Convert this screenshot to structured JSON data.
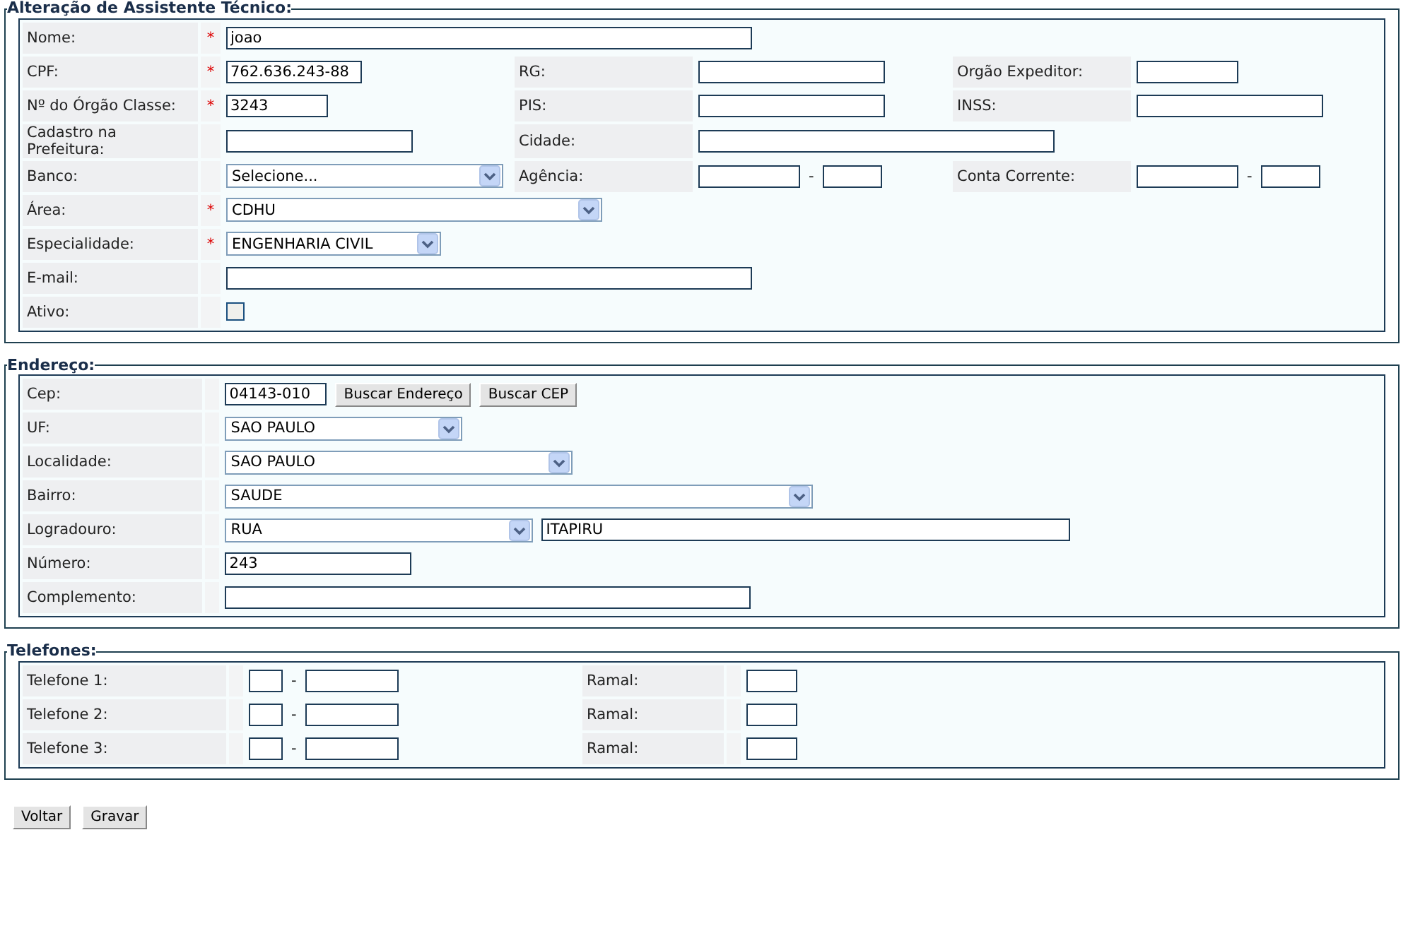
{
  "sections": [
    {
      "title": "Alteração de Assistente Técnico:",
      "rows": [
        {
          "label": "Nome:",
          "required_mark": "*",
          "controls": [
            {
              "kind": "input",
              "value": "joao"
            }
          ]
        },
        {
          "label": "CPF:",
          "required_mark": "*",
          "controls": [
            {
              "kind": "input",
              "value": "762.636.243-88"
            }
          ],
          "extras": [
            {
              "label": "RG:",
              "controls": [
                {
                  "kind": "input"
                }
              ]
            },
            {
              "label": "Orgão Expeditor:",
              "controls": [
                {
                  "kind": "input"
                }
              ]
            }
          ]
        },
        {
          "label": "Nº do Órgão Classe:",
          "required_mark": "*",
          "controls": [
            {
              "kind": "input",
              "value": "3243"
            }
          ],
          "extras": [
            {
              "label": "PIS:",
              "controls": [
                {
                  "kind": "input"
                }
              ]
            },
            {
              "label": "INSS:",
              "controls": [
                {
                  "kind": "input"
                }
              ]
            }
          ]
        },
        {
          "label": "Cadastro na Prefeitura:",
          "controls": [
            {
              "kind": "input"
            }
          ],
          "extras": [
            {
              "label": "Cidade:",
              "controls": [
                {
                  "kind": "input"
                }
              ]
            }
          ]
        },
        {
          "label": "Banco:",
          "controls": [
            {
              "kind": "select",
              "value": "Selecione..."
            }
          ],
          "extras": [
            {
              "label": "Agência:",
              "controls": [
                {
                  "kind": "input"
                },
                {
                  "kind": "dash",
                  "text": "-"
                },
                {
                  "kind": "input"
                }
              ]
            },
            {
              "label": "Conta Corrente:",
              "controls": [
                {
                  "kind": "input"
                },
                {
                  "kind": "dash",
                  "text": "-"
                },
                {
                  "kind": "input"
                }
              ]
            }
          ]
        },
        {
          "label": "Área:",
          "required_mark": "*",
          "controls": [
            {
              "kind": "select",
              "value": "CDHU"
            }
          ]
        },
        {
          "label": "Especialidade:",
          "required_mark": "*",
          "controls": [
            {
              "kind": "select",
              "value": "ENGENHARIA CIVIL"
            }
          ]
        },
        {
          "label": "E-mail:",
          "controls": [
            {
              "kind": "input"
            }
          ]
        },
        {
          "label": "Ativo:",
          "controls": [
            {
              "kind": "checkbox",
              "checked": false
            }
          ]
        }
      ]
    },
    {
      "title": "Endereço:",
      "rows": [
        {
          "label": "Cep:",
          "controls": [
            {
              "kind": "input",
              "value": "04143-010"
            },
            {
              "kind": "button",
              "text": "Buscar Endereço"
            },
            {
              "kind": "button",
              "text": "Buscar CEP"
            }
          ]
        },
        {
          "label": "UF:",
          "controls": [
            {
              "kind": "select",
              "value": "SAO PAULO"
            }
          ]
        },
        {
          "label": "Localidade:",
          "controls": [
            {
              "kind": "select",
              "value": "SAO PAULO"
            }
          ]
        },
        {
          "label": "Bairro:",
          "controls": [
            {
              "kind": "select",
              "value": "SAUDE"
            }
          ]
        },
        {
          "label": "Logradouro:",
          "controls": [
            {
              "kind": "select",
              "value": "RUA"
            },
            {
              "kind": "input",
              "value": "ITAPIRU"
            }
          ]
        },
        {
          "label": "Número:",
          "controls": [
            {
              "kind": "input",
              "value": "243"
            }
          ]
        },
        {
          "label": "Complemento:",
          "controls": [
            {
              "kind": "input"
            }
          ]
        }
      ]
    },
    {
      "title": "Telefones:",
      "rows": [
        {
          "label": "Telefone 1:",
          "controls": [
            {
              "kind": "input"
            },
            {
              "kind": "dash",
              "text": "-"
            },
            {
              "kind": "input"
            }
          ],
          "extras": [
            {
              "label": "Ramal:",
              "controls": [
                {
                  "kind": "input"
                }
              ]
            }
          ]
        },
        {
          "label": "Telefone 2:",
          "controls": [
            {
              "kind": "input"
            },
            {
              "kind": "dash",
              "text": "-"
            },
            {
              "kind": "input"
            }
          ],
          "extras": [
            {
              "label": "Ramal:",
              "controls": [
                {
                  "kind": "input"
                }
              ]
            }
          ]
        },
        {
          "label": "Telefone 3:",
          "controls": [
            {
              "kind": "input"
            },
            {
              "kind": "dash",
              "text": "-"
            },
            {
              "kind": "input"
            }
          ],
          "extras": [
            {
              "label": "Ramal:",
              "controls": [
                {
                  "kind": "input"
                }
              ]
            }
          ]
        }
      ]
    }
  ],
  "buttons": [
    "Voltar",
    "Gravar"
  ]
}
